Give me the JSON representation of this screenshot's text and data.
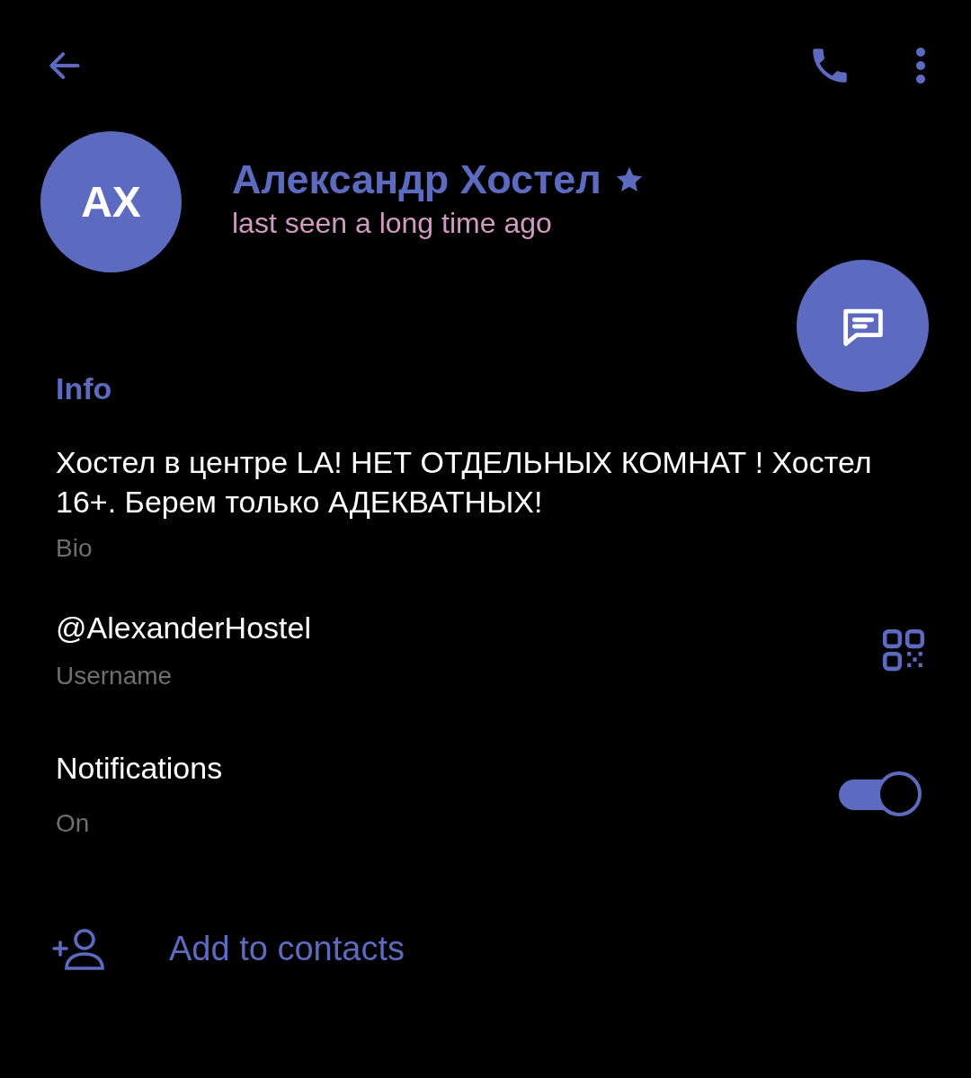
{
  "profile": {
    "initials": "AX",
    "name": "Александр Хостел",
    "status": "last seen a long time ago"
  },
  "info": {
    "title": "Info",
    "bio": {
      "value": "Хостел в центре LA! НЕТ ОТДЕЛЬНЫХ КОМНАТ ! Хостел 16+. Берем только АДЕКВАТНЫХ!",
      "label": "Bio"
    },
    "username": {
      "value": "@AlexanderHostel",
      "label": "Username"
    },
    "notifications": {
      "title": "Notifications",
      "value": "On",
      "on": true
    }
  },
  "actions": [
    {
      "label": "Add to contacts"
    }
  ]
}
